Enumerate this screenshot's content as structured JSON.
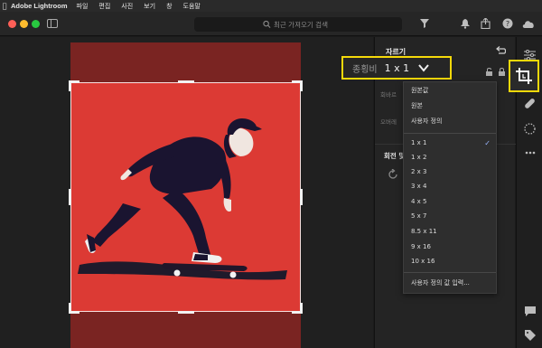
{
  "menubar": {
    "app_name": "Adobe Lightroom",
    "items": [
      "파일",
      "편집",
      "사진",
      "보기",
      "창",
      "도움말"
    ]
  },
  "toolbar": {
    "search_placeholder": "최근 가져오기 검색"
  },
  "panel": {
    "title": "자르기",
    "aspect_label": "종횡비",
    "aspect_value": "1 x 1",
    "ghost_label_1": "회바르",
    "ghost_label_2": "오버레",
    "rotate_title": "회전 및"
  },
  "dropdown": {
    "group1": [
      "원본값",
      "원본",
      "사용자 정의"
    ],
    "ratios": [
      "1 x 1",
      "1 x 2",
      "2 x 3",
      "3 x 4",
      "4 x 5",
      "5 x 7",
      "8.5 x 11",
      "9 x 16",
      "10 x 16"
    ],
    "selected": "1 x 1",
    "custom_entry": "사용자 정의 값 입력..."
  },
  "colors": {
    "highlight": "#f5d90a",
    "photo_bg": "#dc3a34",
    "photo_dim": "#7a2422"
  }
}
